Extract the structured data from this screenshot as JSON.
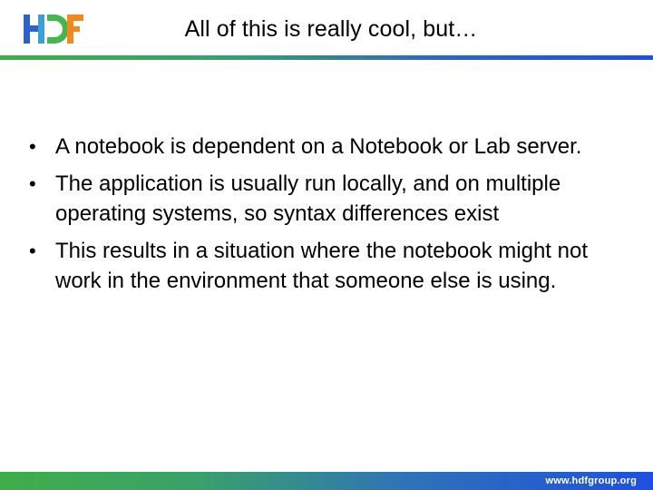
{
  "header": {
    "logo_icon": "hdf-logo-icon",
    "title": "All of this is really cool, but…"
  },
  "bullets": [
    {
      "text": "A notebook is dependent on a Notebook or Lab server."
    },
    {
      "text": "The application is usually run locally, and on multiple operating systems, so syntax differences exist"
    },
    {
      "text": "This results in a situation where the notebook might not work in the environment that someone else is using."
    }
  ],
  "bullet_glyph": "•",
  "footer": {
    "url": "www.hdfgroup.org"
  },
  "colors": {
    "green": "#3fae49",
    "blue": "#1f4fe0",
    "orange": "#f08a1c"
  }
}
